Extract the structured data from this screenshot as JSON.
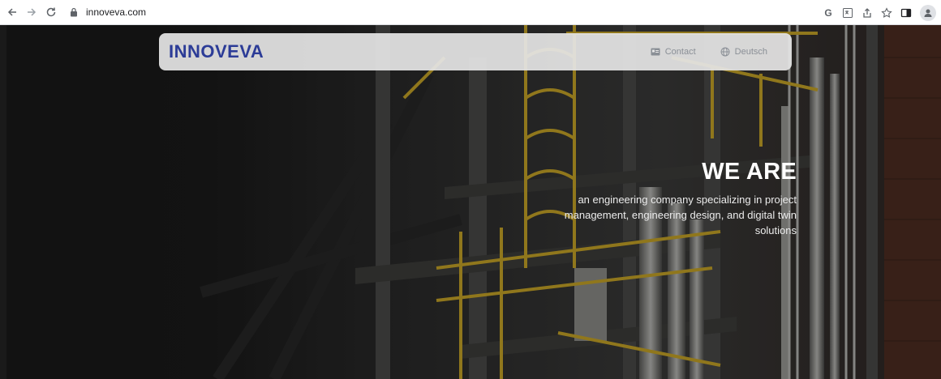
{
  "browser": {
    "url": "innoveva.com",
    "icons": [
      "back-icon",
      "forward-icon",
      "reload-icon",
      "lock-icon",
      "google-icon",
      "translate-icon",
      "share-icon",
      "bookmark-star-icon",
      "side-panel-icon",
      "profile-icon"
    ]
  },
  "header": {
    "logo_text": "INNOVEVA",
    "nav": [
      {
        "label": "Contact",
        "icon": "contact-card-icon"
      },
      {
        "label": "Deutsch",
        "icon": "globe-icon"
      }
    ]
  },
  "hero": {
    "title": "WE ARE",
    "subtitle": "an engineering company specializing in project management, engineering design, and digital twin solutions"
  },
  "colors": {
    "brand": "#2c3c97",
    "header_bg": "#e6e6e6",
    "page_bg": "#191919",
    "accent_yellow": "#c8a628"
  }
}
